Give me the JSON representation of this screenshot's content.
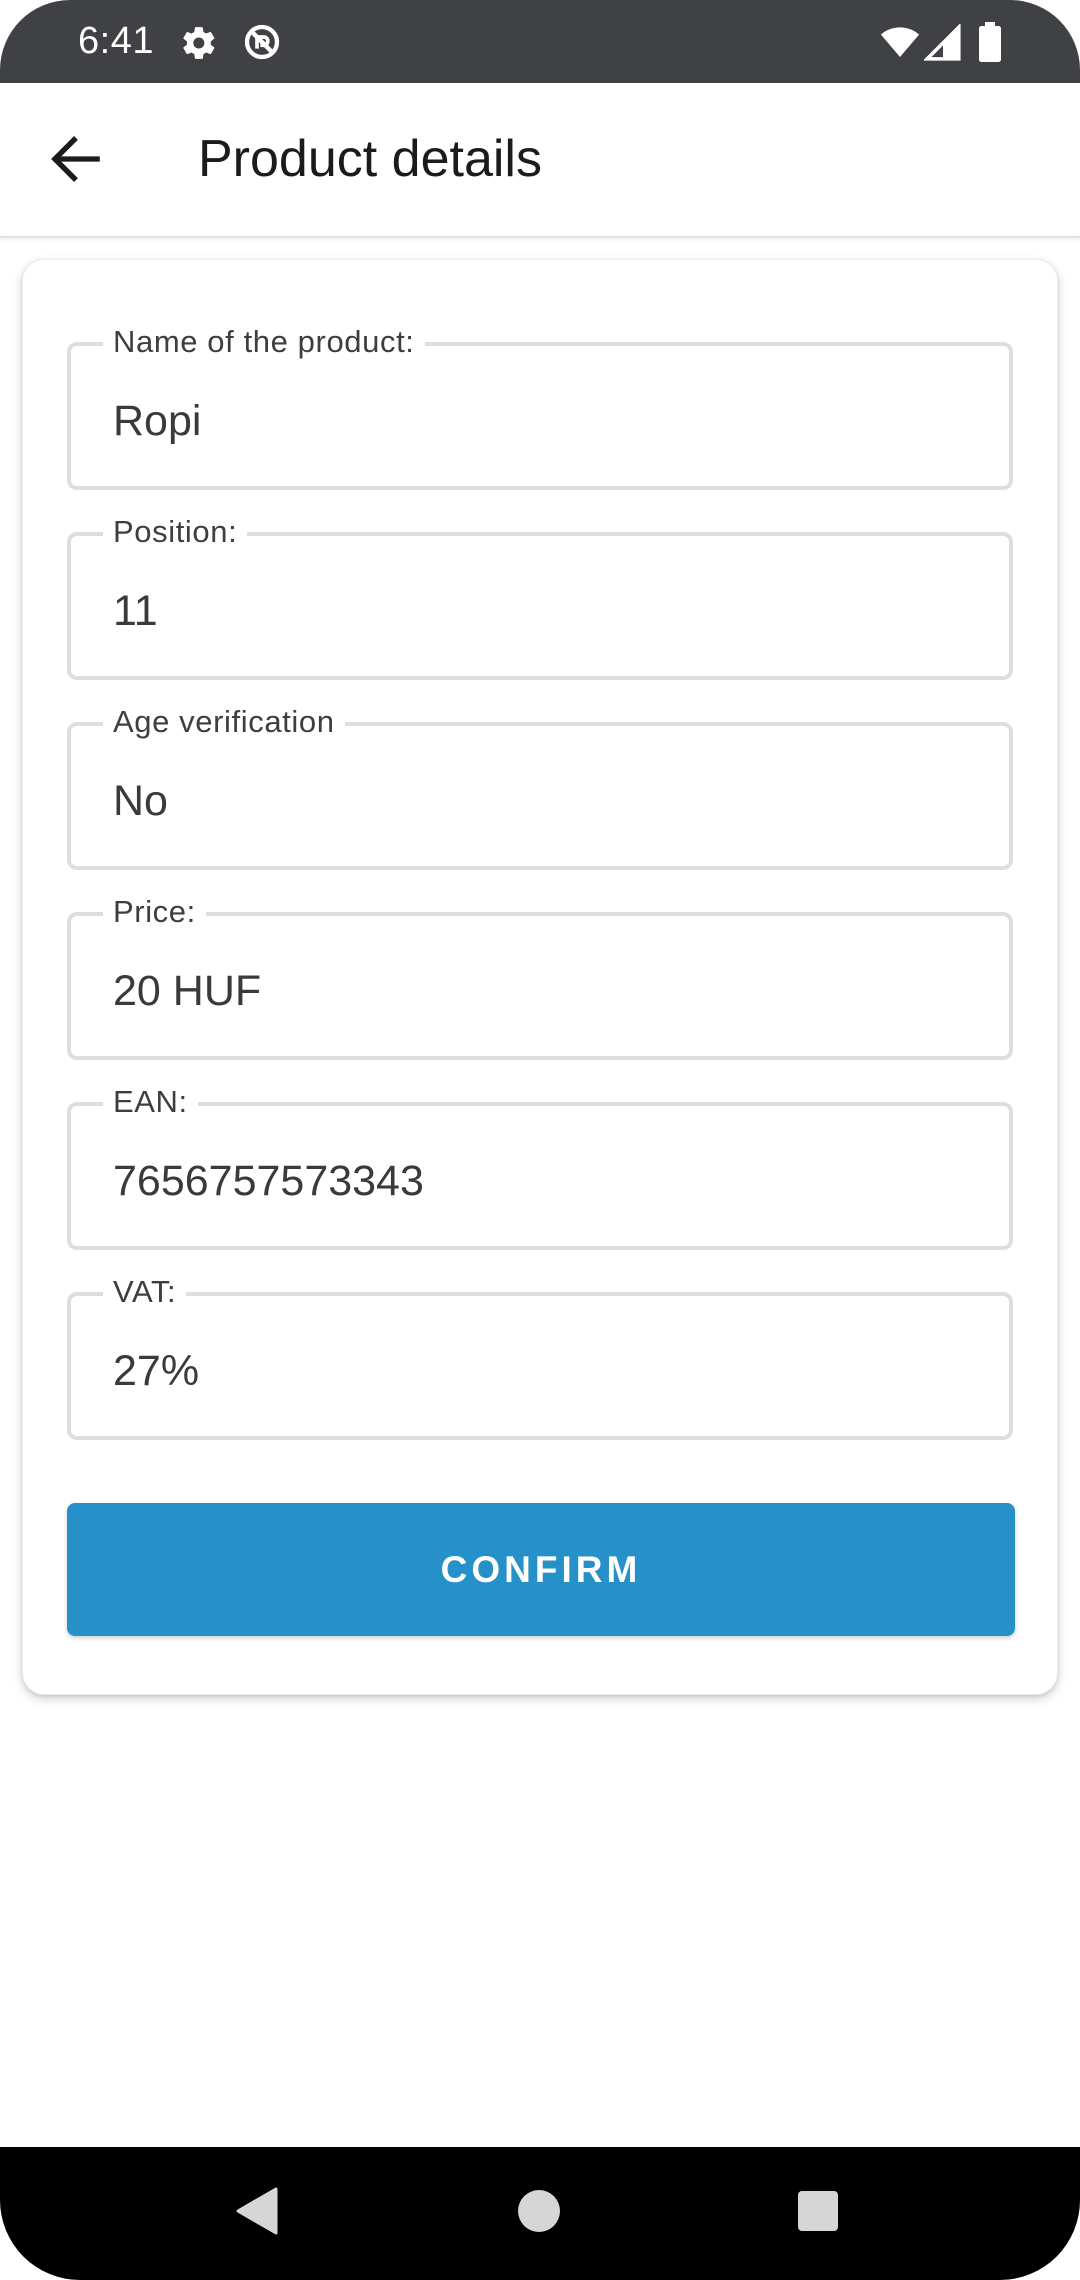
{
  "status_bar": {
    "time": "6:41",
    "icons": [
      "gear-icon",
      "no-sync-icon",
      "wifi-icon",
      "signal-icon",
      "battery-icon"
    ]
  },
  "app_bar": {
    "back_icon": "arrow-back-icon",
    "title": "Product details"
  },
  "form": {
    "fields": [
      {
        "label": "Name of the product:",
        "value": "Ropi"
      },
      {
        "label": "Position:",
        "value": "11"
      },
      {
        "label": "Age verification",
        "value": "No"
      },
      {
        "label": "Price:",
        "value": "20 HUF"
      },
      {
        "label": "EAN:",
        "value": "7656757573343"
      },
      {
        "label": "VAT:",
        "value": "27%"
      }
    ],
    "confirm_label": "CONFIRM"
  },
  "nav_bar": {
    "icons": [
      "nav-back-icon",
      "nav-home-icon",
      "nav-recents-icon"
    ]
  },
  "colors": {
    "status_bar": "#404145",
    "accent": "#2690c8",
    "field_border": "#dedede"
  }
}
